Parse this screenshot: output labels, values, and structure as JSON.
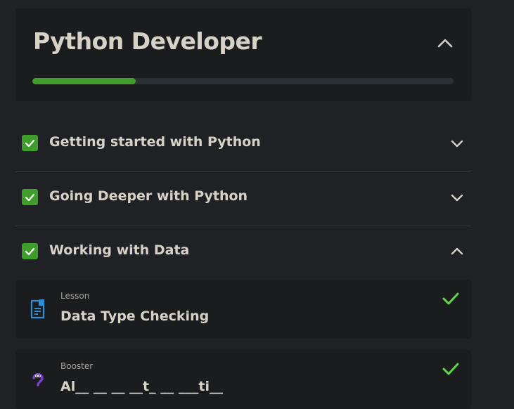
{
  "course": {
    "title": "Python Developer",
    "progress_percent": 24.6
  },
  "sections": [
    {
      "title": "Getting started with Python",
      "completed": true,
      "expanded": false
    },
    {
      "title": "Going Deeper with Python",
      "completed": true,
      "expanded": false
    },
    {
      "title": "Working with Data",
      "completed": true,
      "expanded": true
    }
  ],
  "items": [
    {
      "kind": "Lesson",
      "title": "Data Type Checking",
      "icon": "document-icon",
      "completed": true
    },
    {
      "kind": "Booster",
      "title": "Al__ __ __ __t_ __ ___ti__",
      "icon": "python-mascot-icon",
      "completed": true
    }
  ],
  "colors": {
    "background": "#202124",
    "card": "#1b1c1e",
    "accent_green": "#3f9e2a",
    "check_green": "#5fd64a",
    "lesson_blue": "#2e8fd6",
    "booster_purple": "#7b3fd6",
    "text": "#d6d2c8"
  }
}
